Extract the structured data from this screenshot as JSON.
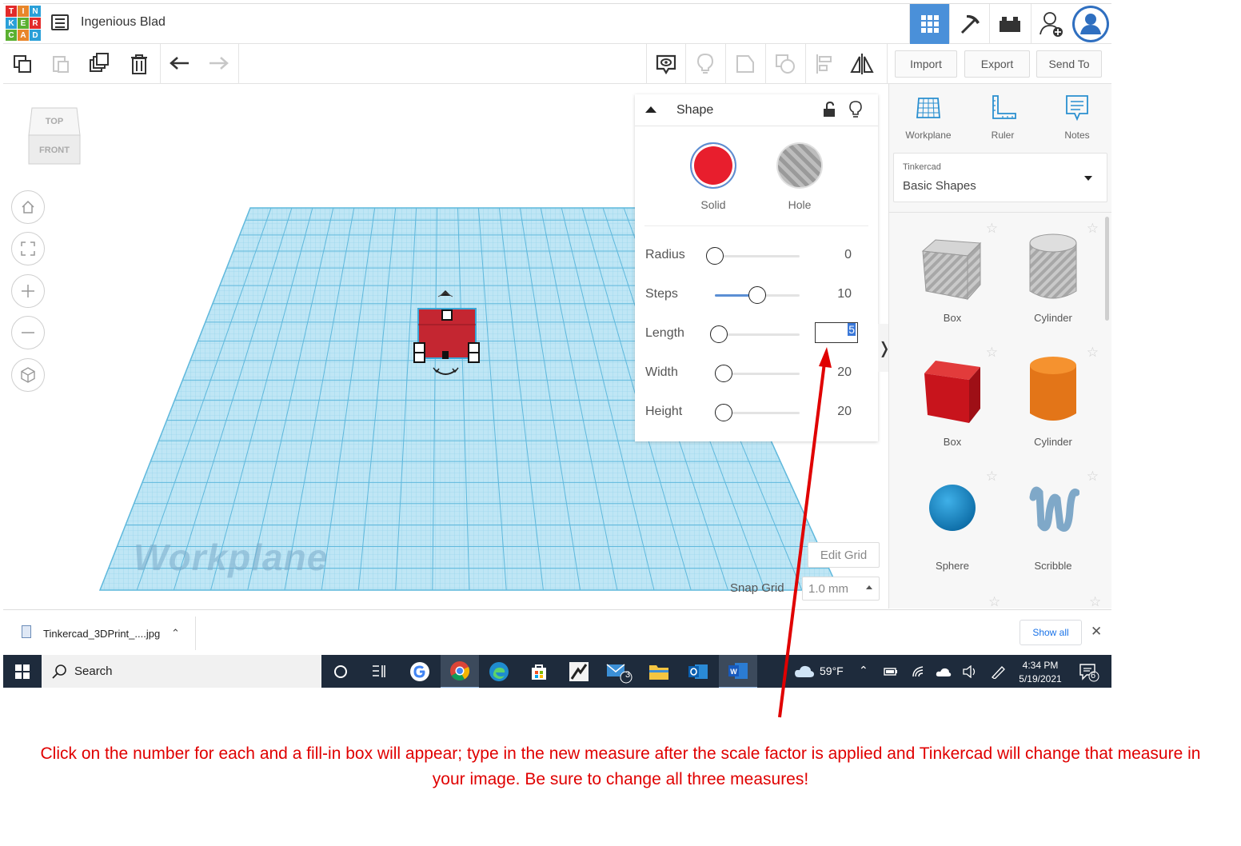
{
  "app": {
    "logo_letters": [
      "T",
      "I",
      "N",
      "K",
      "E",
      "R",
      "C",
      "A",
      "D"
    ],
    "document_title": "Ingenious Blad"
  },
  "toolbar": {
    "import_label": "Import",
    "export_label": "Export",
    "send_to_label": "Send To"
  },
  "viewcube": {
    "top_label": "TOP",
    "front_label": "FRONT"
  },
  "workplane": {
    "label": "Workplane",
    "edit_grid_label": "Edit Grid",
    "snap_grid_label": "Snap Grid",
    "snap_grid_value": "1.0 mm"
  },
  "inspector": {
    "title": "Shape",
    "solid_label": "Solid",
    "hole_label": "Hole",
    "properties": [
      {
        "label": "Radius",
        "value": "0",
        "fraction": 0.0
      },
      {
        "label": "Steps",
        "value": "10",
        "fraction": 0.5
      },
      {
        "label": "Length",
        "value": "5",
        "fraction": 0.05
      },
      {
        "label": "Width",
        "value": "20",
        "fraction": 0.1
      },
      {
        "label": "Height",
        "value": "20",
        "fraction": 0.1
      }
    ]
  },
  "right_panel": {
    "tools": [
      {
        "label": "Workplane",
        "icon": "workplane-icon"
      },
      {
        "label": "Ruler",
        "icon": "ruler-icon"
      },
      {
        "label": "Notes",
        "icon": "notes-icon"
      }
    ],
    "library_owner": "Tinkercad",
    "library_name": "Basic Shapes",
    "shapes": [
      {
        "name": "Box"
      },
      {
        "name": "Cylinder"
      },
      {
        "name": "Box"
      },
      {
        "name": "Cylinder"
      },
      {
        "name": "Sphere"
      },
      {
        "name": "Scribble"
      }
    ]
  },
  "downloads": {
    "file_name": "Tinkercad_3DPrint_....jpg",
    "show_all_label": "Show all"
  },
  "taskbar": {
    "search_placeholder": "Search",
    "mail_badge": "3",
    "weather": "59°F",
    "time": "4:34 PM",
    "date": "5/19/2021",
    "notification_count": "6"
  },
  "caption": {
    "line1": "Click on the number for each and a fill-in box will appear; type in the new measure after the scale factor is applied and Tinkercad will change that measure in",
    "line2": "your image. Be sure to change all three measures!"
  },
  "colors": {
    "accent": "#4a90d9",
    "solid": "#e81e2d",
    "annotation": "#e00000",
    "taskbar": "#1e2b3c"
  }
}
